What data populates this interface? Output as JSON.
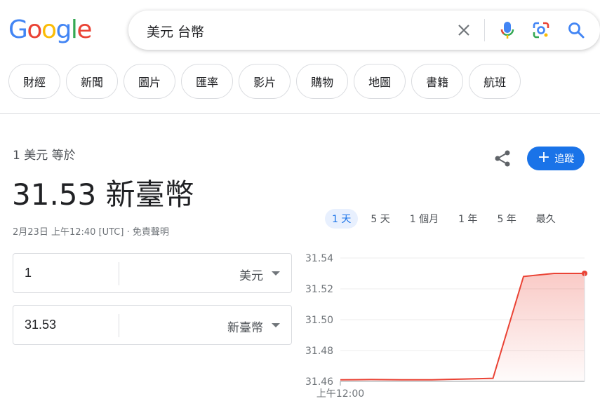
{
  "logo": {
    "letters": [
      "G",
      "o",
      "o",
      "g",
      "l",
      "e"
    ]
  },
  "search": {
    "query": "美元 台幣"
  },
  "chips": [
    "財經",
    "新聞",
    "圖片",
    "匯率",
    "影片",
    "購物",
    "地圖",
    "書籍",
    "航班"
  ],
  "result": {
    "equals_label": "1 美元 等於",
    "value": "31.53 新臺幣",
    "timestamp": "2月23日 上午12:40 [UTC]",
    "separator": " · ",
    "disclaimer": "免責聲明",
    "follow_label": "追蹤"
  },
  "range_tabs": [
    {
      "label": "1 天",
      "active": true
    },
    {
      "label": "5 天",
      "active": false
    },
    {
      "label": "1 個月",
      "active": false
    },
    {
      "label": "1 年",
      "active": false
    },
    {
      "label": "5 年",
      "active": false
    },
    {
      "label": "最久",
      "active": false
    }
  ],
  "converter": {
    "from": {
      "amount": "1",
      "currency": "美元"
    },
    "to": {
      "amount": "31.53",
      "currency": "新臺幣"
    }
  },
  "colors": {
    "accent": "#1a73e8",
    "line": "#ea4335"
  },
  "chart_data": {
    "type": "area",
    "yticks": [
      "31.54",
      "31.52",
      "31.50",
      "31.48",
      "31.46"
    ],
    "ylim": [
      31.46,
      31.54
    ],
    "xtick": "上午12:00",
    "x": [
      0,
      1,
      2,
      3,
      4,
      5,
      6,
      7,
      8
    ],
    "values": [
      31.461,
      31.4612,
      31.461,
      31.461,
      31.4615,
      31.462,
      31.528,
      31.53,
      31.53
    ]
  }
}
